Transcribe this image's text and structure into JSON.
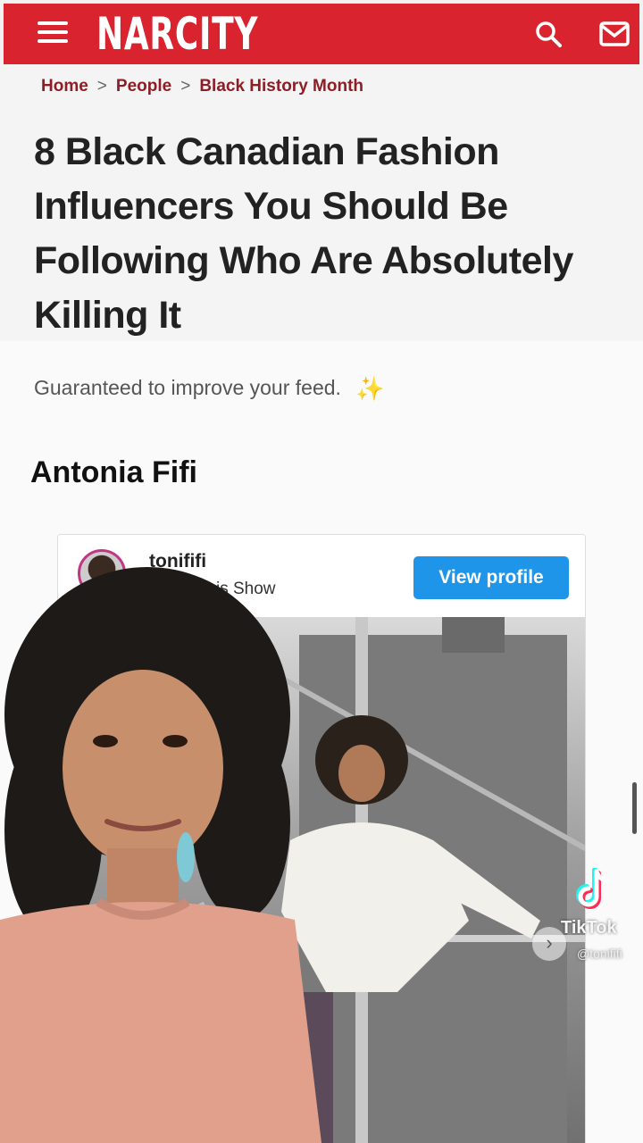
{
  "header": {
    "logo": "NARCITY",
    "menu_icon": "hamburger-menu-icon",
    "search_icon": "search-icon",
    "mail_icon": "mail-icon",
    "brand_color": "#d9232f"
  },
  "breadcrumb": {
    "items": [
      "Home",
      "People",
      "Black History Month"
    ],
    "separator": ">"
  },
  "article": {
    "title": "8 Black Canadian Fashion Influencers You Should Be Following Who Are Absolutely Killing It",
    "subtitle": "Guaranteed to improve your feed.",
    "sparkle": "✨",
    "section_heading": "Antonia Fifi"
  },
  "embed": {
    "username": "tonififi",
    "location": "rilyn Denis Show",
    "view_profile_label": "View profile",
    "button_color": "#1f95e9"
  },
  "tiktok": {
    "brand": "TikTok",
    "handle": "@tonififi"
  }
}
